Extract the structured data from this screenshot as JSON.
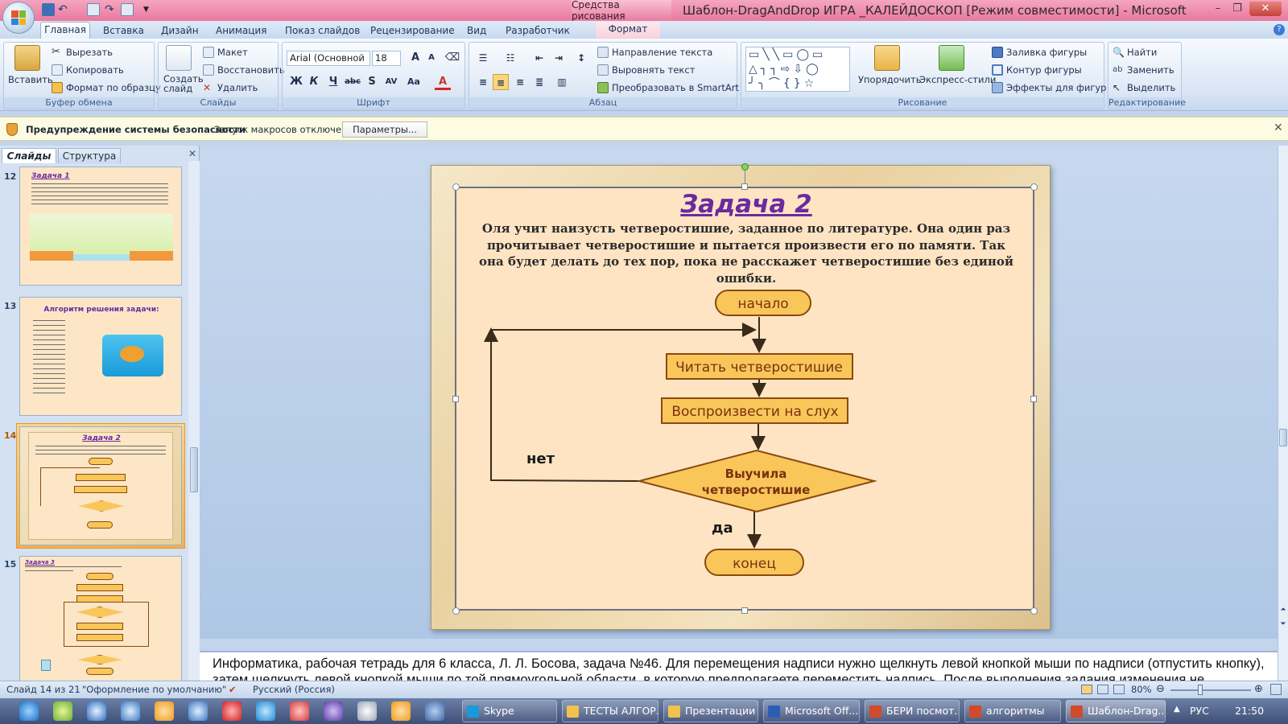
{
  "titlebar": {
    "context_tab": "Средства рисования",
    "title": "Шаблон-DragAndDrop ИГРА _КАЛЕЙДОСКОП [Режим совместимости] - Microsoft PowerP..."
  },
  "ribbon_tabs": [
    "Главная",
    "Вставка",
    "Дизайн",
    "Анимация",
    "Показ слайдов",
    "Рецензирование",
    "Вид",
    "Разработчик"
  ],
  "format_tab": "Формат",
  "clipboard": {
    "paste": "Вставить",
    "cut": "Вырезать",
    "copy": "Копировать",
    "format_painter": "Формат по образцу",
    "title": "Буфер обмена"
  },
  "slides_group": {
    "new_slide": "Создать слайд",
    "layout": "Макет",
    "reset": "Восстановить",
    "delete": "Удалить",
    "title": "Слайды"
  },
  "font_group": {
    "font_name": "Arial (Основной",
    "font_size": "18",
    "title": "Шрифт"
  },
  "paragraph_group": {
    "text_direction": "Направление текста",
    "align_text": "Выровнять текст",
    "smartart": "Преобразовать в SmartArt",
    "title": "Абзац"
  },
  "drawing_group": {
    "arrange": "Упорядочить",
    "quick_styles": "Экспресс-стили",
    "shape_fill": "Заливка фигуры",
    "shape_outline": "Контур фигуры",
    "shape_effects": "Эффекты для фигур",
    "title": "Рисование"
  },
  "editing_group": {
    "find": "Найти",
    "replace": "Заменить",
    "select": "Выделить",
    "title": "Редактирование"
  },
  "security": {
    "title": "Предупреждение системы безопасности",
    "message": "Запуск макросов отключен.",
    "button": "Параметры..."
  },
  "left_pane": {
    "tab_slides": "Слайды",
    "tab_outline": "Структура",
    "slides": [
      {
        "num": "12",
        "title": "Задача 1"
      },
      {
        "num": "13",
        "title": "Алгоритм решения задачи:"
      },
      {
        "num": "14",
        "title": "Задача 2"
      },
      {
        "num": "15",
        "title": "Задача 3"
      }
    ]
  },
  "slide": {
    "title": "Задача 2",
    "text": "Оля учит наизусть четверостишие, заданное по литературе. Она один раз прочитывает четверостишие и пытается произвести его по памяти. Так она будет делать до тех пор, пока не расскажет четверостишие без единой ошибки.",
    "flow": {
      "start": "начало",
      "read": "Читать четверостишие",
      "reproduce": "Воспроизвести на слух",
      "decision_line1": "Выучила",
      "decision_line2": "четверостишие",
      "no": "нет",
      "yes": "да",
      "end": "конец"
    }
  },
  "notes": {
    "text": "Информатика, рабочая тетрадь для 6 класса, Л. Л. Босова, задача №46. Для перемещения надписи нужно щелкнуть левой кнопкой мыши по надписи (отпустить кнопку), затем щелкнуть левой кнопкой мыши по той прямоугольной области, в которую предполагаете переместить надпись. После выполнения задания изменения не сохранять."
  },
  "status": {
    "slide_info": "Слайд 14 из 21",
    "theme": "\"Оформление по умолчанию\"",
    "language": "Русский (Россия)",
    "zoom": "80%"
  },
  "taskbar": {
    "buttons": [
      "Skype",
      "ТЕСТЫ АЛГОР...",
      "Презентации",
      "Microsoft Off...",
      "БЕРИ посмот...",
      "алгоритмы",
      "Шаблон-Drag..."
    ],
    "lang": "РУС",
    "time": "21:50"
  },
  "colors": {
    "title_purple": "#6a2aa0",
    "flow_fill": "#f9c65a",
    "flow_border": "#8a4a10",
    "flow_text": "#7a3210",
    "slide_bg": "#ffe4c4"
  }
}
